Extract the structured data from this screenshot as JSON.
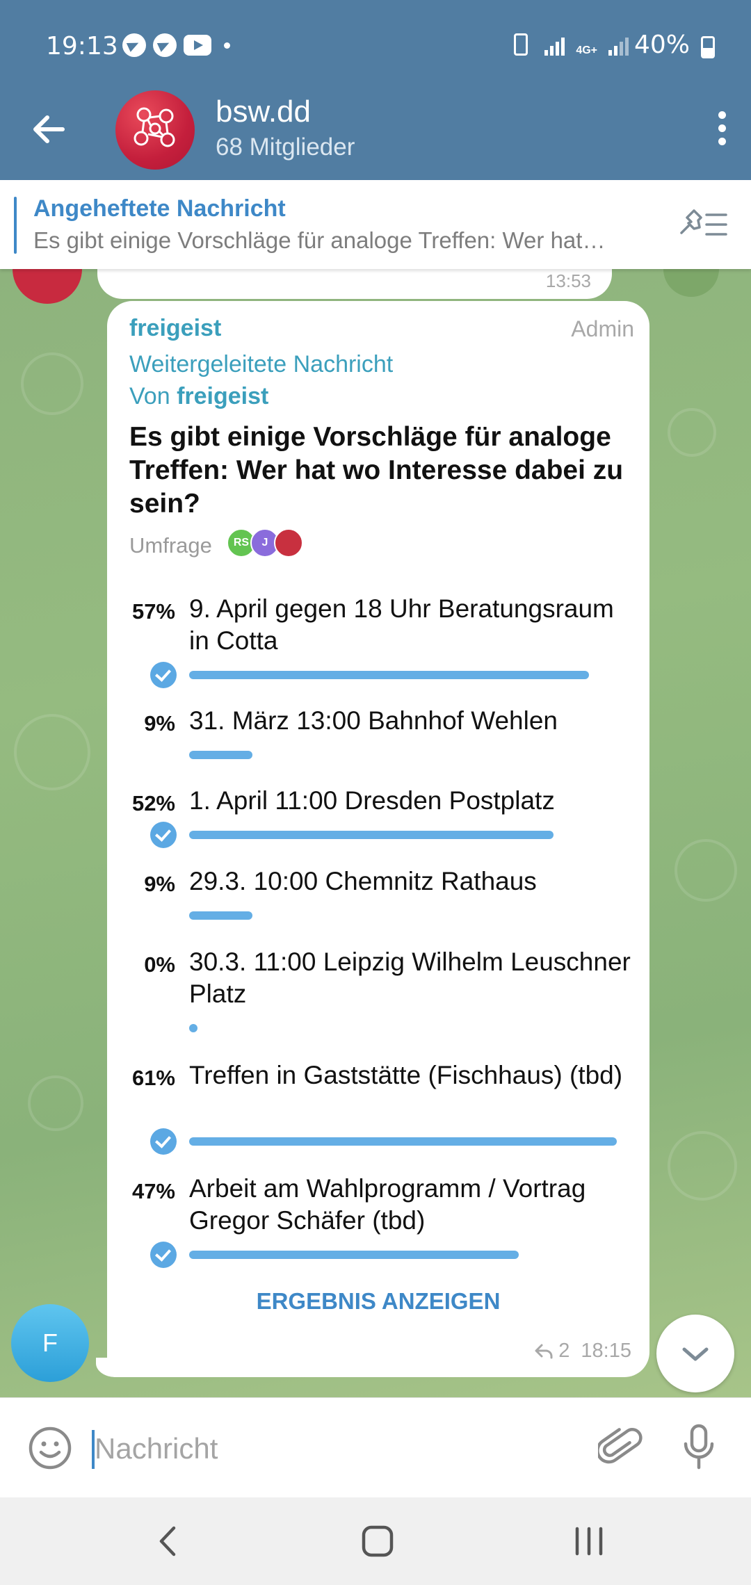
{
  "status_bar": {
    "time": "19:13",
    "battery": "40%",
    "network": "4G+"
  },
  "header": {
    "title": "bsw.dd",
    "subtitle": "68 Mitglieder"
  },
  "pinned": {
    "title": "Angeheftete Nachricht",
    "text": "Es gibt einige Vorschläge für analoge Treffen: Wer hat…"
  },
  "previous_message": {
    "time": "13:53"
  },
  "message": {
    "sender": "freigeist",
    "role": "Admin",
    "forwarded_label": "Weitergeleitete Nachricht",
    "from_prefix": "Von",
    "from_name": "freigeist",
    "question": "Es gibt einige Vorschläge für analoge Treffen: Wer hat wo Interesse dabei zu sein?",
    "poll_type": "Umfrage",
    "voters": [
      "RS",
      "J",
      ""
    ],
    "options": [
      {
        "percent": "57%",
        "fraction": 0.57,
        "text": "9. April gegen 18 Uhr Beratungsraum in Cotta",
        "checked": true
      },
      {
        "percent": "9%",
        "fraction": 0.09,
        "text": "31. März 13:00 Bahnhof Wehlen",
        "checked": false
      },
      {
        "percent": "52%",
        "fraction": 0.52,
        "text": "1. April 11:00 Dresden Postplatz",
        "checked": true
      },
      {
        "percent": "9%",
        "fraction": 0.09,
        "text": "29.3. 10:00 Chemnitz Rathaus",
        "checked": false
      },
      {
        "percent": "0%",
        "fraction": 0.0,
        "text": "30.3. 11:00 Leipzig Wilhelm Leuschner Platz",
        "checked": false
      },
      {
        "percent": "61%",
        "fraction": 0.61,
        "text": "Treffen in Gaststätte (Fischhaus) (tbd)",
        "checked": true
      },
      {
        "percent": "47%",
        "fraction": 0.47,
        "text": "Arbeit am Wahlprogramm / Vortrag Gregor Schäfer (tbd)",
        "checked": true
      }
    ],
    "results_button": "ERGEBNIS ANZEIGEN",
    "replies": "2",
    "time": "18:15"
  },
  "sender_avatar_letter": "F",
  "input": {
    "placeholder": "Nachricht"
  },
  "colors": {
    "header": "#517da2",
    "accent": "#3e88c7",
    "bar": "#64aee5",
    "name": "#3b9fbc"
  }
}
